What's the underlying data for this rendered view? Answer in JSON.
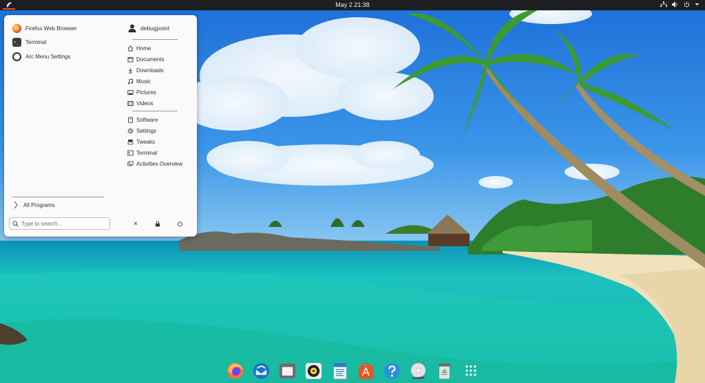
{
  "topbar": {
    "clock": "May 2  21:38",
    "tray_icons": [
      "network-icon",
      "volume-icon",
      "power-icon",
      "chevron-down-icon"
    ]
  },
  "menu": {
    "apps": [
      {
        "label": "Firefox Web Browser",
        "icon": "firefox-icon"
      },
      {
        "label": "Terminal",
        "icon": "terminal-icon"
      },
      {
        "label": "Arc Menu Settings",
        "icon": "arc-menu-settings-icon"
      }
    ],
    "user": {
      "name": "debugpoint"
    },
    "places": [
      {
        "label": "Home",
        "icon": "home-icon"
      },
      {
        "label": "Documents",
        "icon": "documents-icon"
      },
      {
        "label": "Downloads",
        "icon": "downloads-icon"
      },
      {
        "label": "Music",
        "icon": "music-icon"
      },
      {
        "label": "Pictures",
        "icon": "pictures-icon"
      },
      {
        "label": "Videos",
        "icon": "videos-icon"
      }
    ],
    "shortcuts": [
      {
        "label": "Software",
        "icon": "software-icon"
      },
      {
        "label": "Settings",
        "icon": "settings-icon"
      },
      {
        "label": "Tweaks",
        "icon": "tweaks-icon"
      },
      {
        "label": "Terminal",
        "icon": "terminal-icon"
      },
      {
        "label": "Activities Overview",
        "icon": "activities-icon"
      }
    ],
    "all_programs": "All Programs",
    "search": {
      "placeholder": "Type to search..."
    },
    "session_buttons": [
      "close-icon",
      "lock-icon",
      "power-icon"
    ]
  },
  "dock": {
    "items": [
      "firefox-icon",
      "thunderbird-icon",
      "files-icon",
      "rhythmbox-icon",
      "writer-icon",
      "software-center-icon",
      "help-icon",
      "dvd-icon",
      "trash-icon",
      "show-apps-icon"
    ]
  },
  "colors": {
    "topbar_bg": "#1d1f22",
    "menu_bg": "#fafafa",
    "accent": "#e95420",
    "sky": "#2a7fd6",
    "sea": "#1fc7b8"
  }
}
